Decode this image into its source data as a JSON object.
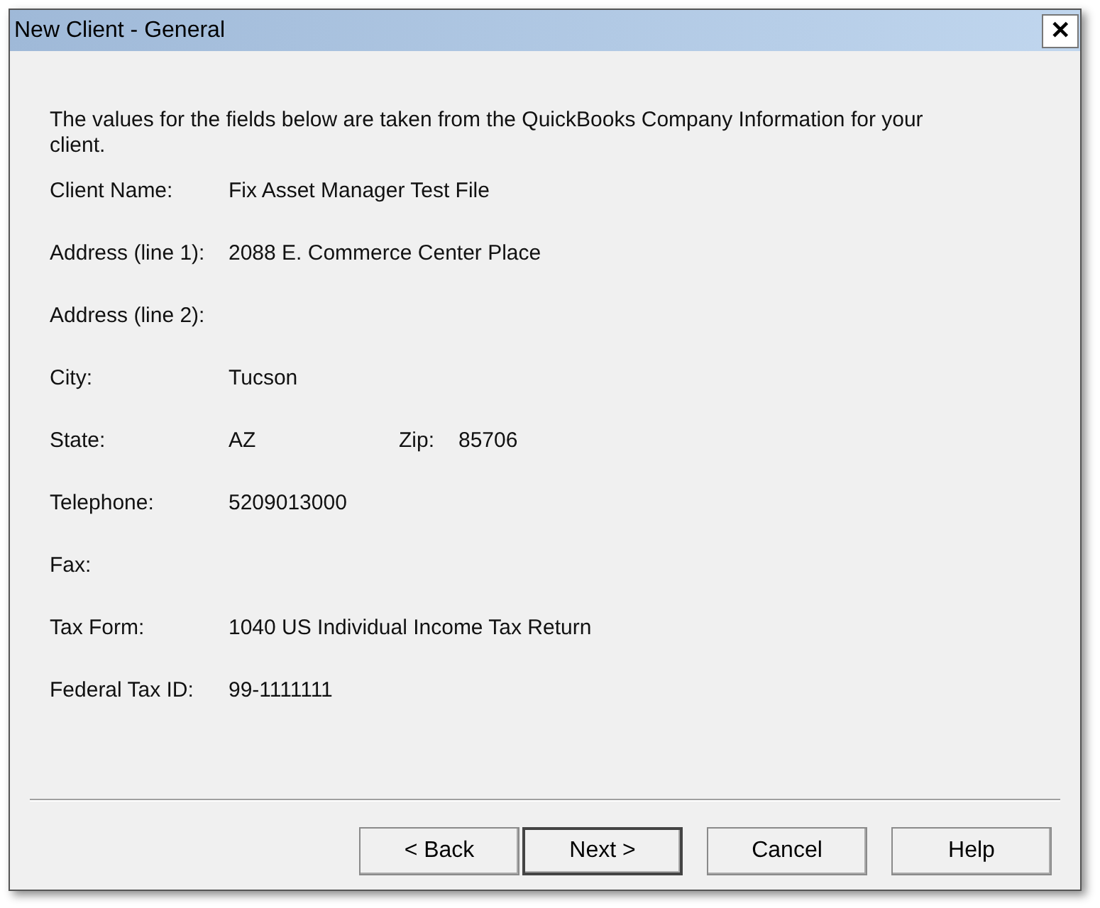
{
  "window": {
    "title": "New Client - General",
    "close": "✕"
  },
  "intro": "The values for the fields below are taken from the QuickBooks Company Information for your client.",
  "fields": [
    {
      "label": "Client Name:",
      "value": "Fix Asset Manager Test File"
    },
    {
      "label": "Address (line 1):",
      "value": "2088 E. Commerce Center Place"
    },
    {
      "label": "Address (line 2):"
    },
    {
      "label": "City:",
      "value": "Tucson"
    },
    {
      "label": "State:",
      "value": "AZ",
      "extra_label": "Zip:",
      "extra_value": "85706"
    },
    {
      "label": "Telephone:",
      "value": "5209013000"
    },
    {
      "label": "Fax:"
    },
    {
      "label": "Tax Form:",
      "value": "1040 US Individual Income Tax Return"
    },
    {
      "label": "Federal Tax ID:",
      "value": "99-1111111"
    }
  ],
  "buttons": [
    {
      "label": "< Back",
      "default": false
    },
    {
      "label": "Next >",
      "default": true
    },
    {
      "label": "Cancel",
      "default": false
    },
    {
      "label": "Help",
      "default": false
    }
  ]
}
